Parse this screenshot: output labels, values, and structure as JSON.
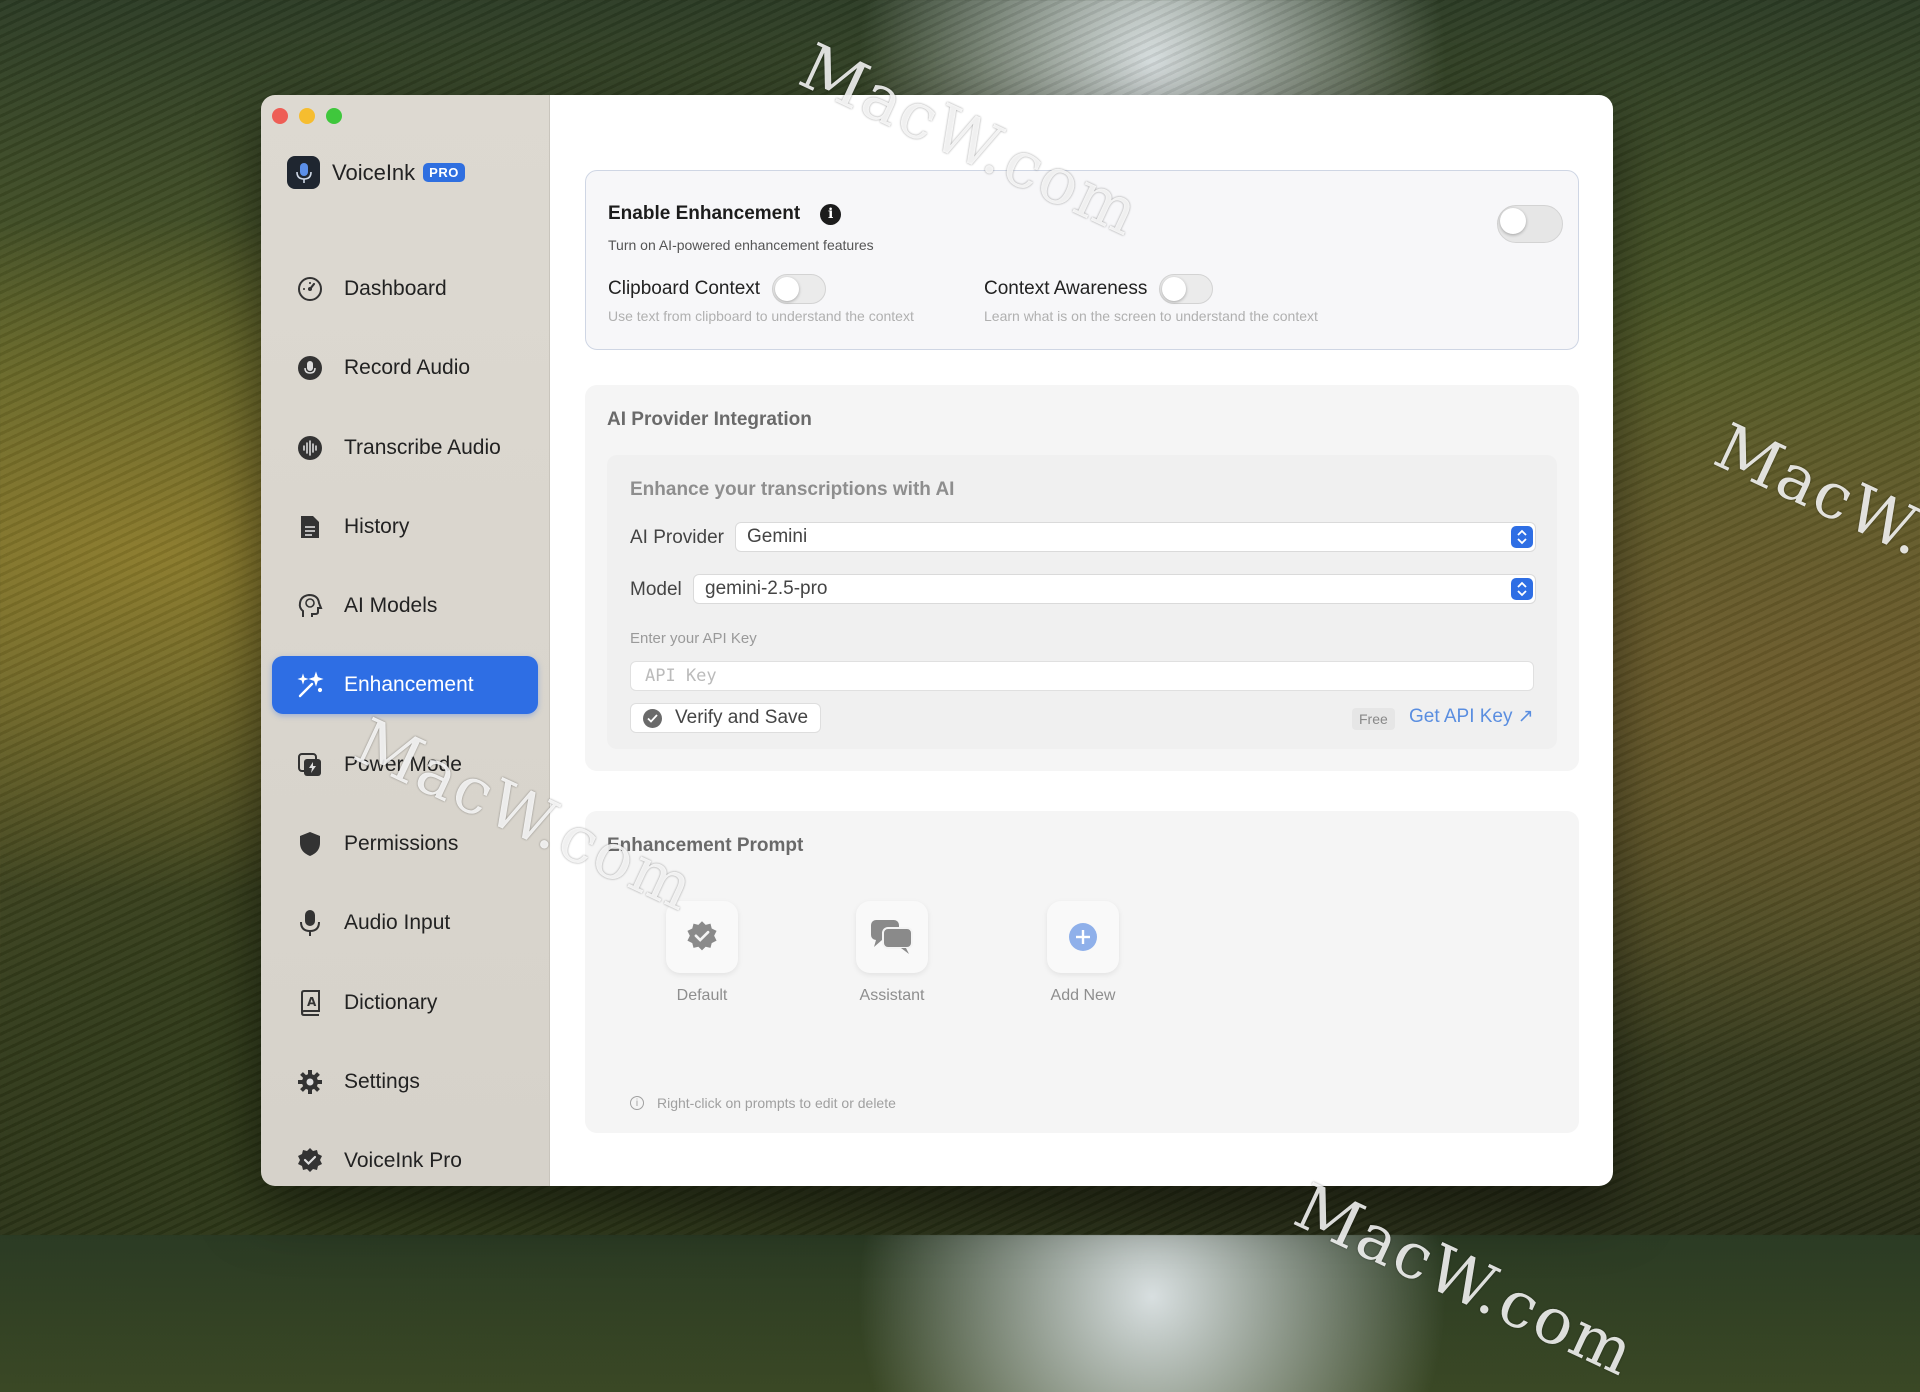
{
  "app": {
    "name": "VoiceInk",
    "badge": "PRO"
  },
  "sidebar": {
    "items": [
      {
        "label": "Dashboard",
        "icon": "gauge-icon"
      },
      {
        "label": "Record Audio",
        "icon": "mic-record-icon"
      },
      {
        "label": "Transcribe Audio",
        "icon": "waveform-icon"
      },
      {
        "label": "History",
        "icon": "document-icon"
      },
      {
        "label": "AI Models",
        "icon": "brain-head-icon"
      },
      {
        "label": "Enhancement",
        "icon": "sparkles-wand-icon",
        "active": true
      },
      {
        "label": "Power Mode",
        "icon": "power-mode-icon"
      },
      {
        "label": "Permissions",
        "icon": "shield-icon"
      },
      {
        "label": "Audio Input",
        "icon": "microphone-icon"
      },
      {
        "label": "Dictionary",
        "icon": "dictionary-book-icon"
      },
      {
        "label": "Settings",
        "icon": "gear-icon"
      },
      {
        "label": "VoiceInk Pro",
        "icon": "verified-badge-icon"
      }
    ]
  },
  "enhancement": {
    "title": "Enable Enhancement",
    "subtitle": "Turn on AI-powered enhancement features",
    "enabled": false,
    "clipboard": {
      "label": "Clipboard Context",
      "desc": "Use text from clipboard to understand the context",
      "enabled": false
    },
    "awareness": {
      "label": "Context Awareness",
      "desc": "Learn what is on the screen to understand the context",
      "enabled": false
    }
  },
  "provider": {
    "section_title": "AI Provider Integration",
    "inner_title": "Enhance your transcriptions with AI",
    "provider_label": "AI Provider",
    "provider_value": "Gemini",
    "model_label": "Model",
    "model_value": "gemini-2.5-pro",
    "api_label": "Enter your API Key",
    "api_placeholder": "API Key",
    "verify_label": "Verify and Save",
    "free_badge": "Free",
    "get_key_label": "Get API Key ↗"
  },
  "prompt": {
    "section_title": "Enhancement Prompt",
    "items": [
      {
        "label": "Default",
        "icon": "verified-badge-icon"
      },
      {
        "label": "Assistant",
        "icon": "chat-bubbles-icon"
      },
      {
        "label": "Add New",
        "icon": "plus-circle-icon"
      }
    ],
    "hint": "Right-click on prompts to edit or delete"
  },
  "watermark": "MacW.com",
  "colors": {
    "accent": "#2e6ee4",
    "sidebar_bg": "#d9d5cd",
    "link": "#5a8ee0"
  }
}
